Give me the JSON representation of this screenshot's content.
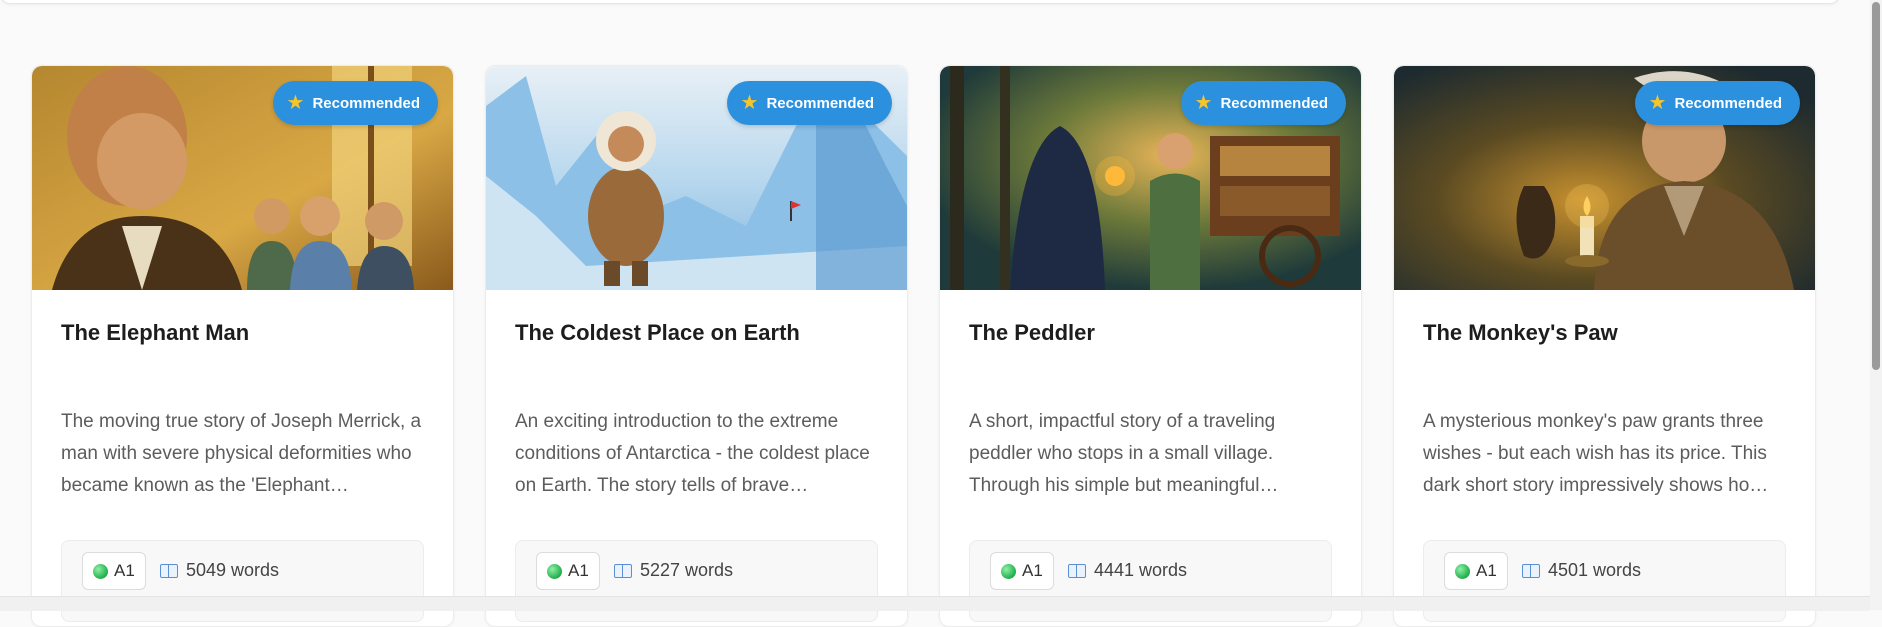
{
  "cards": [
    {
      "badge": "Recommended",
      "title": "The Elephant Man",
      "description": "The moving true story of Joseph Merrick, a man with severe physical deformities who became known as the 'Elephant…",
      "level": "A1",
      "words": "5049 words"
    },
    {
      "badge": "Recommended",
      "title": "The Coldest Place on Earth",
      "description": "An exciting introduction to the extreme conditions of Antarctica - the coldest place on Earth. The story tells of brave…",
      "level": "A1",
      "words": "5227 words"
    },
    {
      "badge": "Recommended",
      "title": "The Peddler",
      "description": "A short, impactful story of a traveling peddler who stops in a small village. Through his simple but meaningful…",
      "level": "A1",
      "words": "4441 words"
    },
    {
      "badge": "Recommended",
      "title": "The Monkey's Paw",
      "description": "A mysterious monkey's paw grants three wishes - but each wish has its price. This dark short story impressively shows ho…",
      "level": "A1",
      "words": "4501 words"
    }
  ],
  "colors": {
    "badge_bg": "#2b90dd",
    "star": "#f7c52a",
    "level_dot": "#1fae4a",
    "book_icon": "#5a8fd6"
  },
  "icons": {
    "badge": "star-icon",
    "level": "green-dot-icon",
    "words": "book-icon"
  }
}
